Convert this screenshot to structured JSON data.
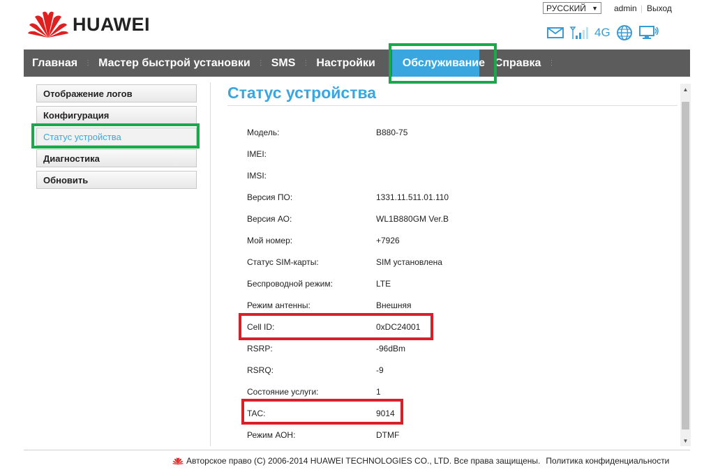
{
  "brand": {
    "name": "HUAWEI"
  },
  "topbar": {
    "language": "РУССКИЙ",
    "user": "admin",
    "logout": "Выход",
    "network_type": "4G"
  },
  "nav": {
    "items": [
      {
        "label": "Главная"
      },
      {
        "label": "Мастер быстрой установки"
      },
      {
        "label": "SMS"
      },
      {
        "label": "Настройки"
      },
      {
        "label": "Обслуживание"
      },
      {
        "label": "Справка"
      }
    ],
    "active_index": 4
  },
  "sidebar": {
    "items": [
      {
        "label": "Отображение логов"
      },
      {
        "label": "Конфигурация"
      },
      {
        "label": "Статус устройства"
      },
      {
        "label": "Диагностика"
      },
      {
        "label": "Обновить"
      }
    ],
    "active_index": 2
  },
  "main": {
    "title": "Статус устройства",
    "rows": [
      {
        "label": "Модель:",
        "value": "B880-75"
      },
      {
        "label": "IMEI:",
        "value": ""
      },
      {
        "label": "IMSI:",
        "value": ""
      },
      {
        "label": "Версия ПО:",
        "value": "1331.11.511.01.110"
      },
      {
        "label": "Версия АО:",
        "value": "WL1B880GM Ver.B"
      },
      {
        "label": "Мой номер:",
        "value": "+7926"
      },
      {
        "label": "Статус SIM-карты:",
        "value": "SIM установлена"
      },
      {
        "label": "Беспроводной режим:",
        "value": "LTE"
      },
      {
        "label": "Режим антенны:",
        "value": "Внешняя"
      },
      {
        "label": "Cell ID:",
        "value": "0xDC24001"
      },
      {
        "label": "RSRP:",
        "value": "-96dBm"
      },
      {
        "label": "RSRQ:",
        "value": "-9"
      },
      {
        "label": "Состояние услуги:",
        "value": "1"
      },
      {
        "label": "TAC:",
        "value": "9014"
      },
      {
        "label": "Режим АОН:",
        "value": "DTMF"
      }
    ]
  },
  "footer": {
    "copyright": "Авторское право (C) 2006-2014 HUAWEI TECHNOLOGIES CO., LTD. Все права защищены.",
    "privacy": "Политика конфиденциальности"
  },
  "colors": {
    "accent": "#3aa6e0",
    "nav_bg": "#5c5c5c",
    "highlight_green": "#1aa84a",
    "highlight_red": "#d8202a",
    "brand_red": "#e02020"
  }
}
